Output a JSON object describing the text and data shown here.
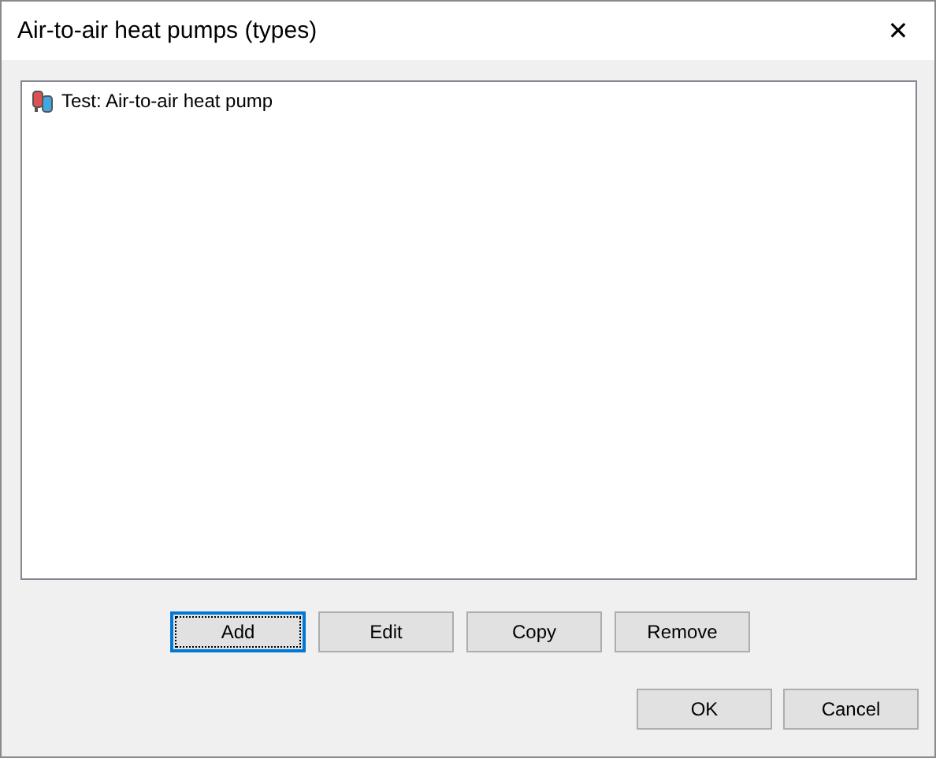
{
  "window": {
    "title": "Air-to-air heat pumps (types)",
    "close": "✕"
  },
  "list": {
    "items": [
      {
        "label": "Test: Air-to-air heat pump",
        "selected": false
      }
    ]
  },
  "actions": [
    {
      "label": "Add",
      "focused": true
    },
    {
      "label": "Edit",
      "focused": false
    },
    {
      "label": "Copy",
      "focused": false
    },
    {
      "label": "Remove",
      "focused": false
    }
  ],
  "dialog_buttons": [
    {
      "label": "OK",
      "focused": false
    },
    {
      "label": "Cancel",
      "focused": false
    }
  ]
}
